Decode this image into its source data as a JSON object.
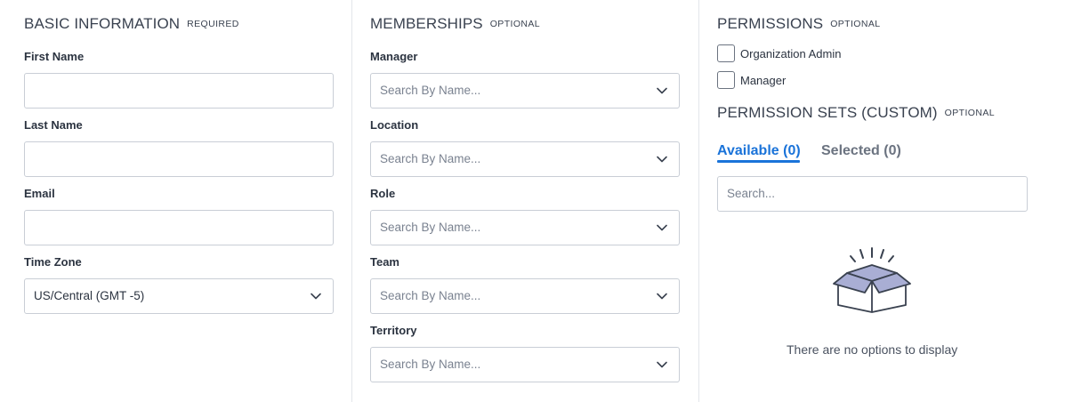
{
  "basic_information": {
    "title": "BASIC INFORMATION",
    "tag": "REQUIRED",
    "fields": [
      {
        "label": "First Name",
        "value": ""
      },
      {
        "label": "Last Name",
        "value": ""
      },
      {
        "label": "Email",
        "value": ""
      }
    ],
    "time_zone": {
      "label": "Time Zone",
      "value": "US/Central (GMT -5)"
    }
  },
  "memberships": {
    "title": "MEMBERSHIPS",
    "tag": "OPTIONAL",
    "fields": [
      {
        "label": "Manager",
        "placeholder": "Search By Name..."
      },
      {
        "label": "Location",
        "placeholder": "Search By Name..."
      },
      {
        "label": "Role",
        "placeholder": "Search By Name..."
      },
      {
        "label": "Team",
        "placeholder": "Search By Name..."
      },
      {
        "label": "Territory",
        "placeholder": "Search By Name..."
      }
    ]
  },
  "permissions": {
    "title": "PERMISSIONS",
    "tag": "OPTIONAL",
    "options": [
      {
        "label": "Organization Admin",
        "checked": false
      },
      {
        "label": "Manager",
        "checked": false
      }
    ]
  },
  "permission_sets": {
    "title": "PERMISSION SETS (CUSTOM)",
    "tag": "OPTIONAL",
    "tabs": [
      {
        "label": "Available (0)",
        "active": true
      },
      {
        "label": "Selected (0)",
        "active": false
      }
    ],
    "search_placeholder": "Search...",
    "empty_message": "There are no options to display",
    "empty_icon": "open-box-icon"
  },
  "colors": {
    "accent": "#1a73d9",
    "border": "#c9ced6",
    "box_fill": "#a9aed4"
  }
}
